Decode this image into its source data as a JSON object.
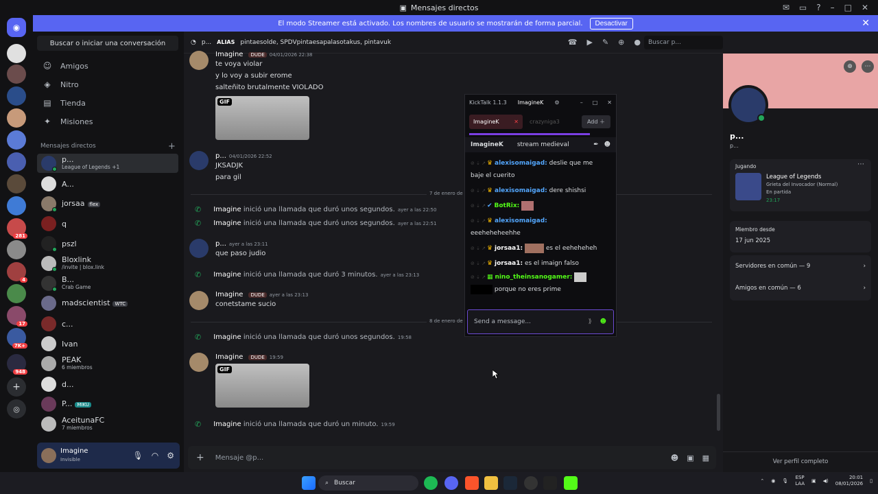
{
  "window": {
    "title": "Mensajes directos"
  },
  "streamer_banner": {
    "text": "El modo Streamer está activado. Los nombres de usuario se mostrarán de forma parcial.",
    "button": "Desactivar"
  },
  "sidebar": {
    "search_label": "Buscar o iniciar una conversación",
    "nav": [
      "Amigos",
      "Nitro",
      "Tienda",
      "Misiones"
    ],
    "dm_header": "Mensajes directos",
    "dms": [
      {
        "name": "p...",
        "sub": "League of Legends +1",
        "active": true
      },
      {
        "name": "A...",
        "sub": ""
      },
      {
        "name": "jorsaa",
        "sub": "",
        "tag": "flex"
      },
      {
        "name": "q",
        "sub": ""
      },
      {
        "name": "pszl",
        "sub": ""
      },
      {
        "name": "Bloxlink",
        "sub": "/invite | blox.link"
      },
      {
        "name": "B...",
        "sub": "Crab Game"
      },
      {
        "name": "madscientist",
        "sub": "",
        "tag": "WTC"
      },
      {
        "name": "c...",
        "sub": ""
      },
      {
        "name": "Ivan",
        "sub": ""
      },
      {
        "name": "PEAK",
        "sub": "6 miembros"
      },
      {
        "name": "d...",
        "sub": ""
      },
      {
        "name": "P...",
        "sub": "",
        "tag": "MIKU"
      },
      {
        "name": "AceitunaFC",
        "sub": "7 miembros"
      }
    ],
    "rail_badges": [
      "281",
      "4",
      "17",
      "7K+",
      "948"
    ]
  },
  "user": {
    "name": "Imagine",
    "status": "Invisible"
  },
  "chat": {
    "header_name": "p...",
    "alias_label": "ALIAS",
    "alias_value": "pintaesolde, SPDVpintaesapalasotakus, pintavuk",
    "search_placeholder": "Buscar p...",
    "composer_placeholder": "Mensaje @p...",
    "messages": [
      {
        "author": "Imagine",
        "tag": "DUDE",
        "time": "04/01/2026 22:38",
        "lines": [
          "te voya violar",
          "y lo voy a subir erome",
          "salteñito brutalmente VIOLADO"
        ],
        "gif": "GIF"
      },
      {
        "author": "p...",
        "time": "04/01/2026 22:52",
        "lines": [
          "JKSADJK",
          "para gil"
        ]
      },
      {
        "divider": "7 de enero de 20"
      },
      {
        "call": "Imagine",
        "text": "inició una llamada que duró unos segundos.",
        "time": "ayer a las 22:50"
      },
      {
        "call": "Imagine",
        "text": "inició una llamada que duró unos segundos.",
        "time": "ayer a las 22:51"
      },
      {
        "author": "p...",
        "time": "ayer a las 23:11",
        "lines": [
          "que paso judio"
        ]
      },
      {
        "call": "Imagine",
        "text": "inició una llamada que duró 3 minutos.",
        "time": "ayer a las 23:13"
      },
      {
        "author": "Imagine",
        "tag": "DUDE",
        "time": "ayer a las 23:13",
        "lines": [
          "conetstame sucio"
        ]
      },
      {
        "divider": "8 de enero de 20"
      },
      {
        "call": "Imagine",
        "text": "inició una llamada que duró unos segundos.",
        "time": "19:58"
      },
      {
        "author": "Imagine",
        "tag": "DUDE",
        "time": "19:59",
        "gif": "GIF"
      },
      {
        "call": "Imagine",
        "text": "inició una llamada que duró un minuto.",
        "time": "19:59"
      }
    ]
  },
  "profile": {
    "name": "p...",
    "sub": "p...",
    "playing_label": "Jugando",
    "game": "League of Legends",
    "game_detail": "Grieta del Invocador (Normal)",
    "game_state": "En partida",
    "game_time": "23:17",
    "member_since_label": "Miembro desde",
    "member_since": "17 jun 2025",
    "servers_common": "Servidores en común — 9",
    "friends_common": "Amigos en común — 6",
    "view_full": "Ver perfil completo"
  },
  "kicktalk": {
    "version": "KickTalk 1.1.3",
    "user": "ImagineK",
    "tab_active": "ImagineK",
    "tab_inactive": "crazyniga3",
    "add_label": "Add",
    "channel_name": "ImagineK",
    "stream_title": "stream medieval",
    "send_placeholder": "Send a message...",
    "chat": [
      {
        "user": "alexisomaigad:",
        "text": "deslie que me baje el cuerito"
      },
      {
        "user": "alexisomaigad:",
        "text": "dere shishsi"
      },
      {
        "user": "BotRix:",
        "text": "",
        "green": true
      },
      {
        "user": "alexisomaigad:",
        "text": "eeeheheheehhe"
      },
      {
        "user": "jorsaa1:",
        "text": "es el eeheheheh",
        "white": true
      },
      {
        "user": "jorsaa1:",
        "text": "es el imaign falso",
        "white": true
      },
      {
        "user": "nino_theinsanogamer:",
        "text": "porque no eres prime",
        "green": true
      }
    ]
  },
  "taskbar": {
    "search": "Buscar",
    "lang": "ESP",
    "lang2": "LAA",
    "time": "20:01",
    "date": "08/01/2026"
  }
}
